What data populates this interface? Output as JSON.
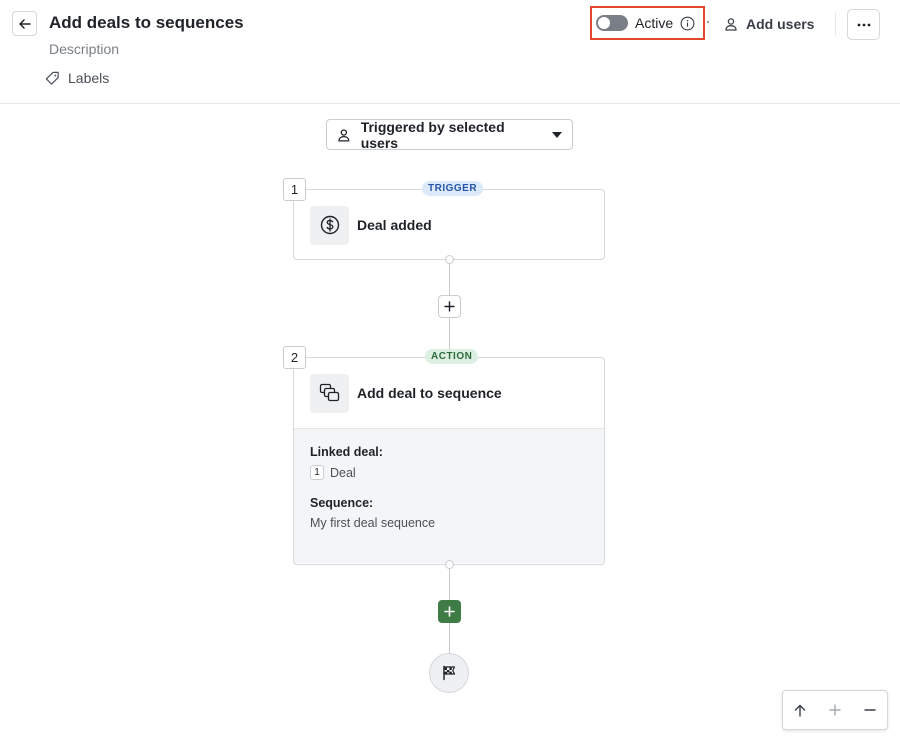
{
  "header": {
    "title": "Add deals to sequences",
    "description": "Description",
    "labels": "Labels",
    "active_label": "Active",
    "add_users": "Add users"
  },
  "trigger_selector": {
    "label": "Triggered by selected users"
  },
  "steps": [
    {
      "number": "1",
      "badge": "TRIGGER",
      "title": "Deal added",
      "icon": "dollar-circle-icon"
    },
    {
      "number": "2",
      "badge": "ACTION",
      "title": "Add deal to sequence",
      "icon": "sequence-icon",
      "fields": [
        {
          "label": "Linked deal:",
          "ref_number": "1",
          "value": "Deal"
        },
        {
          "label": "Sequence:",
          "value": "My first deal sequence"
        }
      ]
    }
  ],
  "colors": {
    "highlight": "#e2462b",
    "add_step_green": "#3f7c45",
    "trigger_badge": "#dbe9fb",
    "action_badge": "#dcefe2"
  }
}
